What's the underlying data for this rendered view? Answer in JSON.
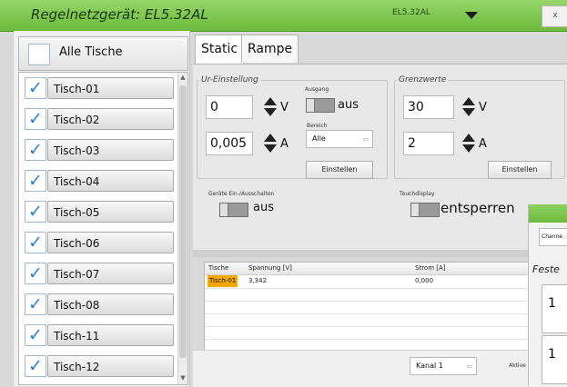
{
  "window": {
    "title": "Regelnetzgerät: EL5.32AL",
    "device_dropdown": "EL5.32AL",
    "close_label": "x"
  },
  "sidebar": {
    "all_label": "Alle Tische",
    "items": [
      {
        "label": "Tisch-01",
        "checked": true
      },
      {
        "label": "Tisch-02",
        "checked": true
      },
      {
        "label": "Tisch-03",
        "checked": true
      },
      {
        "label": "Tisch-04",
        "checked": true
      },
      {
        "label": "Tisch-05",
        "checked": true
      },
      {
        "label": "Tisch-06",
        "checked": true
      },
      {
        "label": "Tisch-07",
        "checked": true
      },
      {
        "label": "Tisch-08",
        "checked": true
      },
      {
        "label": "Tisch-11",
        "checked": true
      },
      {
        "label": "Tisch-12",
        "checked": true
      }
    ],
    "check_glyph": "✓"
  },
  "tabs": [
    "Static",
    "Rampe"
  ],
  "ui_group": {
    "legend": "Ur-Einstellung",
    "voltage": "0",
    "voltage_unit": "V",
    "current": "0,005",
    "current_unit": "A",
    "ausgang_label": "Ausgang",
    "ausgang_state": "aus",
    "bereich_label": "Bereich",
    "bereich_value": "Alle",
    "apply": "Einstellen"
  },
  "limits_group": {
    "legend": "Grenzwerte",
    "voltage": "30",
    "voltage_unit": "V",
    "current": "2",
    "current_unit": "A",
    "apply": "Einstellen"
  },
  "switches": {
    "devices_label": "Geräte Ein-/Ausschalten",
    "devices_state": "aus",
    "touch_label": "Touchdisplay",
    "touch_state": "entsperren"
  },
  "table": {
    "headers": [
      "Tische",
      "Spannung [V]",
      "Strom [A]"
    ],
    "rows": [
      [
        "Tisch-01",
        "3,342",
        "0,000"
      ]
    ]
  },
  "bottom": {
    "channel": "Kanal 1",
    "extra": "Aktive"
  },
  "float_panel": {
    "channel": "Channe",
    "title": "Feste",
    "value1": "1",
    "value2": "1"
  },
  "colors": {
    "titlebar": "#7cc44a",
    "highlight": "#f5a800",
    "check": "#2b7fd6"
  }
}
